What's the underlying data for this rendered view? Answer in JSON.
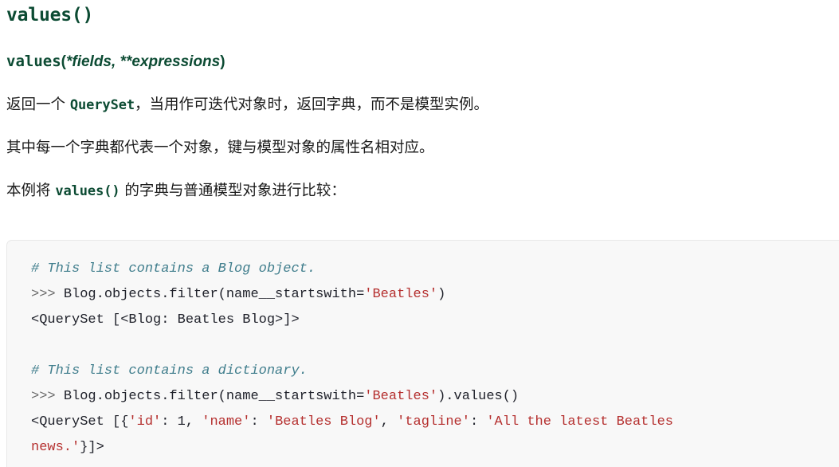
{
  "heading": "values()",
  "signature": {
    "name": "values",
    "open_paren": "(",
    "params": "*fields, **expressions",
    "close_paren": ")"
  },
  "paragraphs": [
    {
      "before": "返回一个 ",
      "code": "QuerySet",
      "after": "，当用作可迭代对象时，返回字典，而不是模型实例。"
    },
    {
      "before": "其中每一个字典都代表一个对象，键与模型对象的属性名相对应。",
      "code": "",
      "after": ""
    },
    {
      "before": "本例将 ",
      "code": "values()",
      "after": " 的字典与普通模型对象进行比较："
    }
  ],
  "code_block": {
    "language": "python-console",
    "lines": [
      {
        "id": "line-1",
        "tokens": [
          {
            "type": "comment",
            "text": "# This list contains a Blog object."
          }
        ]
      },
      {
        "id": "line-2",
        "tokens": [
          {
            "type": "prompt",
            "text": ">>> "
          },
          {
            "type": "plain",
            "text": "Blog.objects.filter(name__startswith="
          },
          {
            "type": "str",
            "text": "'Beatles'"
          },
          {
            "type": "plain",
            "text": ")"
          }
        ]
      },
      {
        "id": "line-3",
        "tokens": [
          {
            "type": "plain",
            "text": "<QuerySet [<Blog: Beatles Blog>]>"
          }
        ]
      },
      {
        "id": "line-4",
        "tokens": []
      },
      {
        "id": "line-5",
        "tokens": [
          {
            "type": "comment",
            "text": "# This list contains a dictionary."
          }
        ]
      },
      {
        "id": "line-6",
        "tokens": [
          {
            "type": "prompt",
            "text": ">>> "
          },
          {
            "type": "plain",
            "text": "Blog.objects.filter(name__startswith="
          },
          {
            "type": "str",
            "text": "'Beatles'"
          },
          {
            "type": "plain",
            "text": ").values()"
          }
        ]
      },
      {
        "id": "line-7",
        "tokens": [
          {
            "type": "plain",
            "text": "<QuerySet [{"
          },
          {
            "type": "str",
            "text": "'id'"
          },
          {
            "type": "plain",
            "text": ": "
          },
          {
            "type": "num",
            "text": "1"
          },
          {
            "type": "plain",
            "text": ", "
          },
          {
            "type": "str",
            "text": "'name'"
          },
          {
            "type": "plain",
            "text": ": "
          },
          {
            "type": "str",
            "text": "'Beatles Blog'"
          },
          {
            "type": "plain",
            "text": ", "
          },
          {
            "type": "str",
            "text": "'tagline'"
          },
          {
            "type": "plain",
            "text": ": "
          },
          {
            "type": "str",
            "text": "'All the latest Beatles"
          }
        ]
      },
      {
        "id": "line-8",
        "tokens": [
          {
            "type": "str",
            "text": "news.'"
          },
          {
            "type": "plain",
            "text": "}]>"
          }
        ]
      }
    ]
  },
  "colors": {
    "django_green": "#0C4B33",
    "body_text": "#1b1b1b",
    "code_bg": "#f8f8f8",
    "code_border": "#e8e8e8",
    "token_comment": "#3f7d8c",
    "token_prompt": "#6c6c6c",
    "token_string": "#b5302f",
    "token_plain": "#20222b"
  }
}
